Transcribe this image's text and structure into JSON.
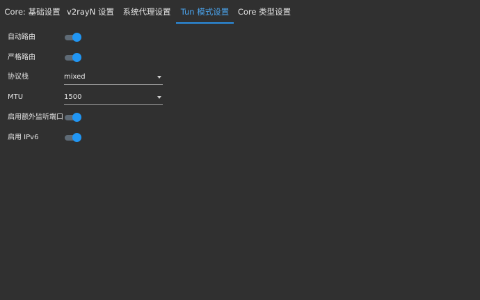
{
  "tabs": [
    {
      "label": "Core: 基础设置",
      "active": false
    },
    {
      "label": "v2rayN 设置",
      "active": false
    },
    {
      "label": "系统代理设置",
      "active": false
    },
    {
      "label": "Tun 模式设置",
      "active": true
    },
    {
      "label": "Core 类型设置",
      "active": false
    }
  ],
  "settings": {
    "auto_route": {
      "label": "自动路由",
      "enabled": true
    },
    "strict_route": {
      "label": "严格路由",
      "enabled": true
    },
    "stack": {
      "label": "协议栈",
      "value": "mixed"
    },
    "mtu": {
      "label": "MTU",
      "value": "1500"
    },
    "extra_listen_port": {
      "label": "启用额外监听端口",
      "enabled": true
    },
    "ipv6": {
      "label": "启用 IPv6",
      "enabled": true
    }
  },
  "colors": {
    "background": "#303030",
    "accent": "#2196f3",
    "active_tab_text": "#4aa3ec",
    "toggle_track": "#5e6a75"
  }
}
